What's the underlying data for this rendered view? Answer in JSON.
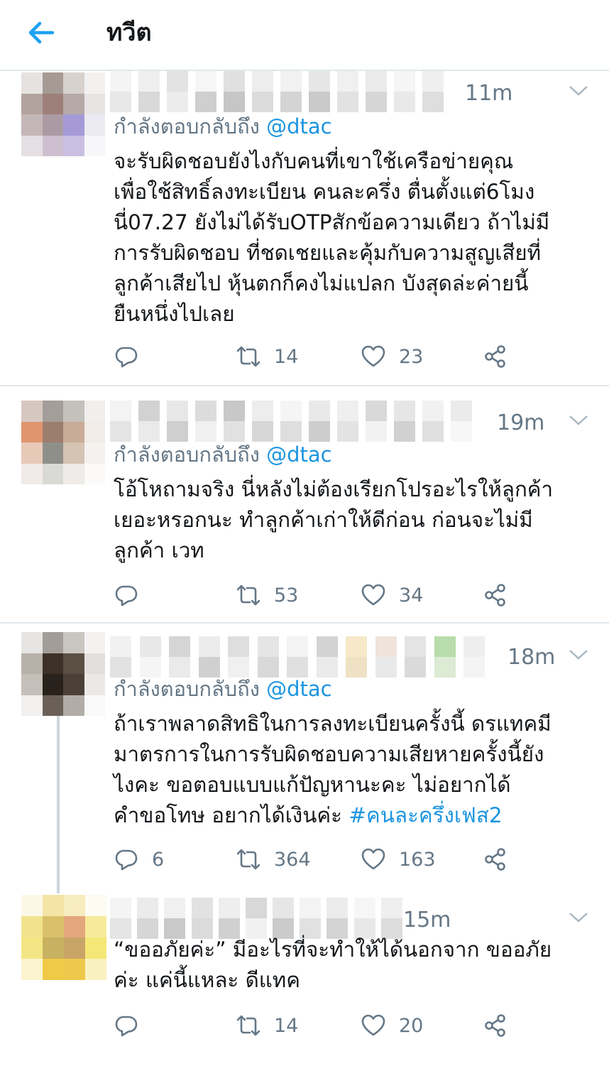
{
  "header": {
    "title": "ทวีต",
    "back_icon": "arrow-left-icon",
    "accent": "#1da1f2"
  },
  "tweets": [
    {
      "time": "11m",
      "reply_prefix": "กำลังตอบกลับถึง",
      "reply_handle": "@dtac",
      "text": "จะรับผิดชอบยังไงกับคนที่เขาใช้เครือข่ายคุณ\nเพื่อใช้สิทธิ์ลงทะเบียน คนละครึ่ง ตื่นตั้งแต่6โมง\nนี่07.27 ยังไม่ได้รับOTPสักข้อความเดียว ถ้าไม่มี\nการรับผิดชอบ ที่ชดเชยและคุ้มกับความสูญเสียที่\nลูกค้าเสียไป หุ้นตกก็คงไม่แปลก บังสุดล่ะค่ายนี้\nยืนหนึ่งไปเลย",
      "replies": "",
      "retweets": "14",
      "likes": "23"
    },
    {
      "time": "19m",
      "reply_prefix": "กำลังตอบกลับถึง",
      "reply_handle": "@dtac",
      "text": "โอ้โหถามจริง นี่หลังไม่ต้องเรียกโปรอะไรให้ลูกค้า\nเยอะหรอกนะ ทำลูกค้าเก่าให้ดีก่อน ก่อนจะไม่มี\nลูกค้า เวท",
      "replies": "",
      "retweets": "53",
      "likes": "34"
    },
    {
      "time": "18m",
      "reply_prefix": "กำลังตอบกลับถึง",
      "reply_handle": "@dtac",
      "text": "ถ้าเราพลาดสิทธิในการลงทะเบียนครั้งนี้ ดรแทคมี\nมาตรการในการรับผิดชอบความเสียหายครั้งนี้ยัง\nไงคะ ขอตอบแบบแก้ปัญหานะคะ ไม่อยากได้\nคำขอโทษ อยากได้เงินค่ะ ",
      "hashtag": "#คนละครึ่งเฟส2",
      "replies": "6",
      "retweets": "364",
      "likes": "163"
    },
    {
      "time": "15m",
      "text": "“ขออภัยค่ะ” มีอะไรที่จะทำให้ได้นอกจาก ขออภัย\nค่ะ แค่นี้แหละ ดีแทค",
      "replies": "",
      "retweets": "14",
      "likes": "20"
    }
  ]
}
